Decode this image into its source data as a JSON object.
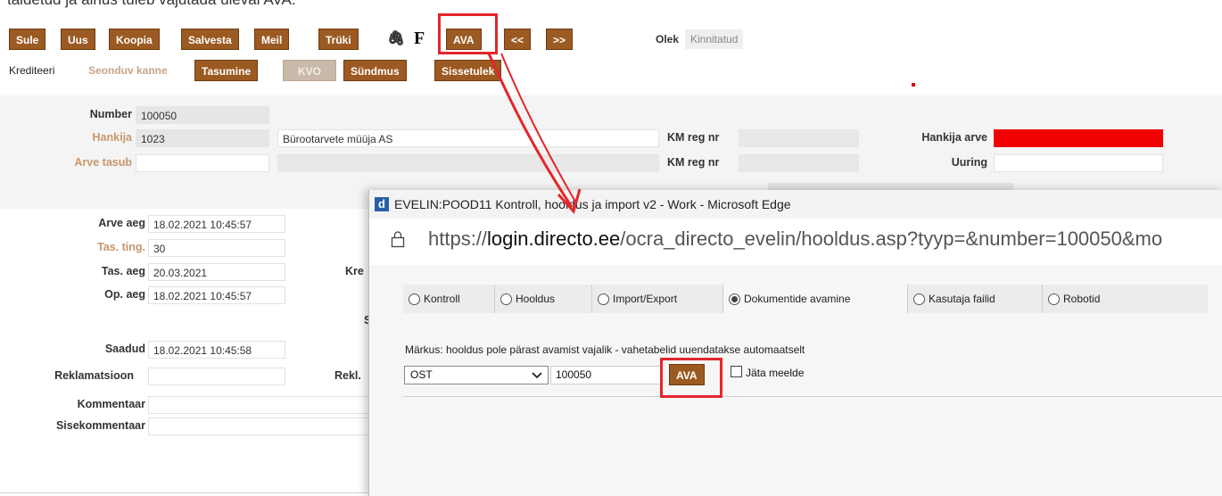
{
  "top_text": "täidetud ja ainus tuleb vajutada üleval AVA.",
  "toolbar": {
    "buttons": [
      "Sule",
      "Uus",
      "Koopia",
      "Salvesta",
      "Meil",
      "Trüki"
    ],
    "attach_glyph": "🖇",
    "f_label": "F",
    "ava": "AVA",
    "prev": "<<",
    "next": ">>",
    "olek_label": "Olek",
    "olek_value": "Kinnitatud"
  },
  "toolbar2": {
    "krediteeri": "Krediteeri",
    "seonduv_kanne": "Seonduv kanne",
    "tasumine": "Tasumine",
    "kvo": "KVO",
    "syndmus": "Sündmus",
    "sissetulek": "Sissetulek"
  },
  "header_form": {
    "number_label": "Number",
    "number_value": "100050",
    "hankija_label": "Hankija",
    "hankija_code": "1023",
    "hankija_name": "Bürootarvete müüja AS",
    "km_reg_nr_label": "KM reg nr",
    "hankija_arve_label": "Hankija arve",
    "arve_tasub_label": "Arve tasub",
    "km_reg_nr2_label": "KM reg nr",
    "uuring_label": "Uuring"
  },
  "body_form": {
    "arve_aeg_label": "Arve aeg",
    "arve_aeg_value": "18.02.2021 10:45:57",
    "tas_ting_label": "Tas. ting.",
    "tas_ting_value": "30",
    "tas_aeg_label": "Tas. aeg",
    "tas_aeg_value": "20.03.2021",
    "kre_label": "Kre",
    "op_aeg_label": "Op. aeg",
    "op_aeg_value": "18.02.2021 10:45:57",
    "s_label": "S",
    "saadud_label": "Saadud",
    "saadud_value": "18.02.2021 10:45:58",
    "reklamatsioon_label": "Reklamatsioon",
    "rekl_label": "Rekl.",
    "kommentaar_label": "Kommentaar",
    "sisekommentaar_label": "Sisekommentaar"
  },
  "popup": {
    "title": "EVELIN:POOD11 Kontroll, hooldus ja import v2 - Work - Microsoft Edge",
    "logo_glyph": "d",
    "url_prefix": "https://",
    "url_host": "login.directo.ee",
    "url_path": "/ocra_directo_evelin/hooldus.asp?tyyp=&number=100050&mo",
    "tabs": [
      "Kontroll",
      "Hooldus",
      "Import/Export",
      "Dokumentide avamine",
      "Kasutaja failid",
      "Robotid"
    ],
    "active_tab": 3,
    "note": "Märkus: hooldus pole pärast avamist vajalik - vahetabelid uuendatakse automaatselt",
    "select_value": "OST",
    "number_value": "100050",
    "ava_button": "AVA",
    "remember_label": "Jäta meelde"
  },
  "colors": {
    "button": "#9b5a22",
    "highlight": "#e3262c",
    "hankija_arve_required": "#f00000"
  }
}
